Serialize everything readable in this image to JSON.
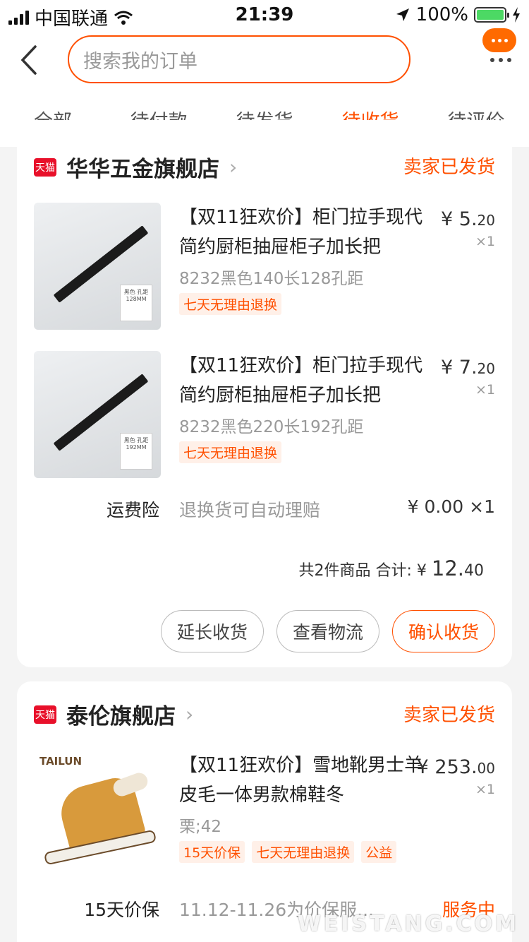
{
  "status_bar": {
    "carrier": "中国联通",
    "time": "21:39",
    "battery": "100%"
  },
  "search": {
    "placeholder": "搜索我的订单"
  },
  "tabs": [
    {
      "label": "全部"
    },
    {
      "label": "待付款"
    },
    {
      "label": "待发货"
    },
    {
      "label": "待收货"
    },
    {
      "label": "待评价"
    }
  ],
  "orders": [
    {
      "shop_badge": "天猫",
      "shop_name": "华华五金旗舰店",
      "status": "卖家已发货",
      "items": [
        {
          "title": "【双11狂欢价】柜门拉手现代简约厨柜抽屉柜子加长把",
          "spec": "8232黑色140长128孔距",
          "badges": [
            "七天无理由退换"
          ],
          "price_int": "5.",
          "price_dec": "20",
          "qty": "×1",
          "thumb_tag": "黑色 孔距128MM"
        },
        {
          "title": "【双11狂欢价】柜门拉手现代简约厨柜抽屉柜子加长把",
          "spec": "8232黑色220长192孔距",
          "badges": [
            "七天无理由退换"
          ],
          "price_int": "7.",
          "price_dec": "20",
          "qty": "×1",
          "thumb_tag": "黑色 孔距192MM"
        }
      ],
      "insurance": {
        "label": "运费险",
        "desc": "退换货可自动理赔",
        "value": "¥ 0.00 ×1"
      },
      "total_prefix": "共2件商品 合计: ¥",
      "total_int": "12.",
      "total_dec": "40",
      "buttons": {
        "extend": "延长收货",
        "logistics": "查看物流",
        "confirm": "确认收货"
      }
    },
    {
      "shop_badge": "天猫",
      "shop_name": "泰伦旗舰店",
      "status": "卖家已发货",
      "items": [
        {
          "title": "【双11狂欢价】雪地靴男士羊皮毛一体男款棉鞋冬",
          "spec": "栗;42",
          "badges": [
            "15天价保",
            "七天无理由退换",
            "公益"
          ],
          "price_int": "253.",
          "price_dec": "00",
          "qty": "×1",
          "brand": "TAILUN"
        }
      ],
      "price_guard": {
        "label": "15天价保",
        "desc": "11.12-11.26为价保服...",
        "value": "服务中"
      }
    }
  ],
  "watermark": "WEISTANG.COM",
  "colors": {
    "accent": "#ff5000",
    "tmall": "#e8102a"
  }
}
